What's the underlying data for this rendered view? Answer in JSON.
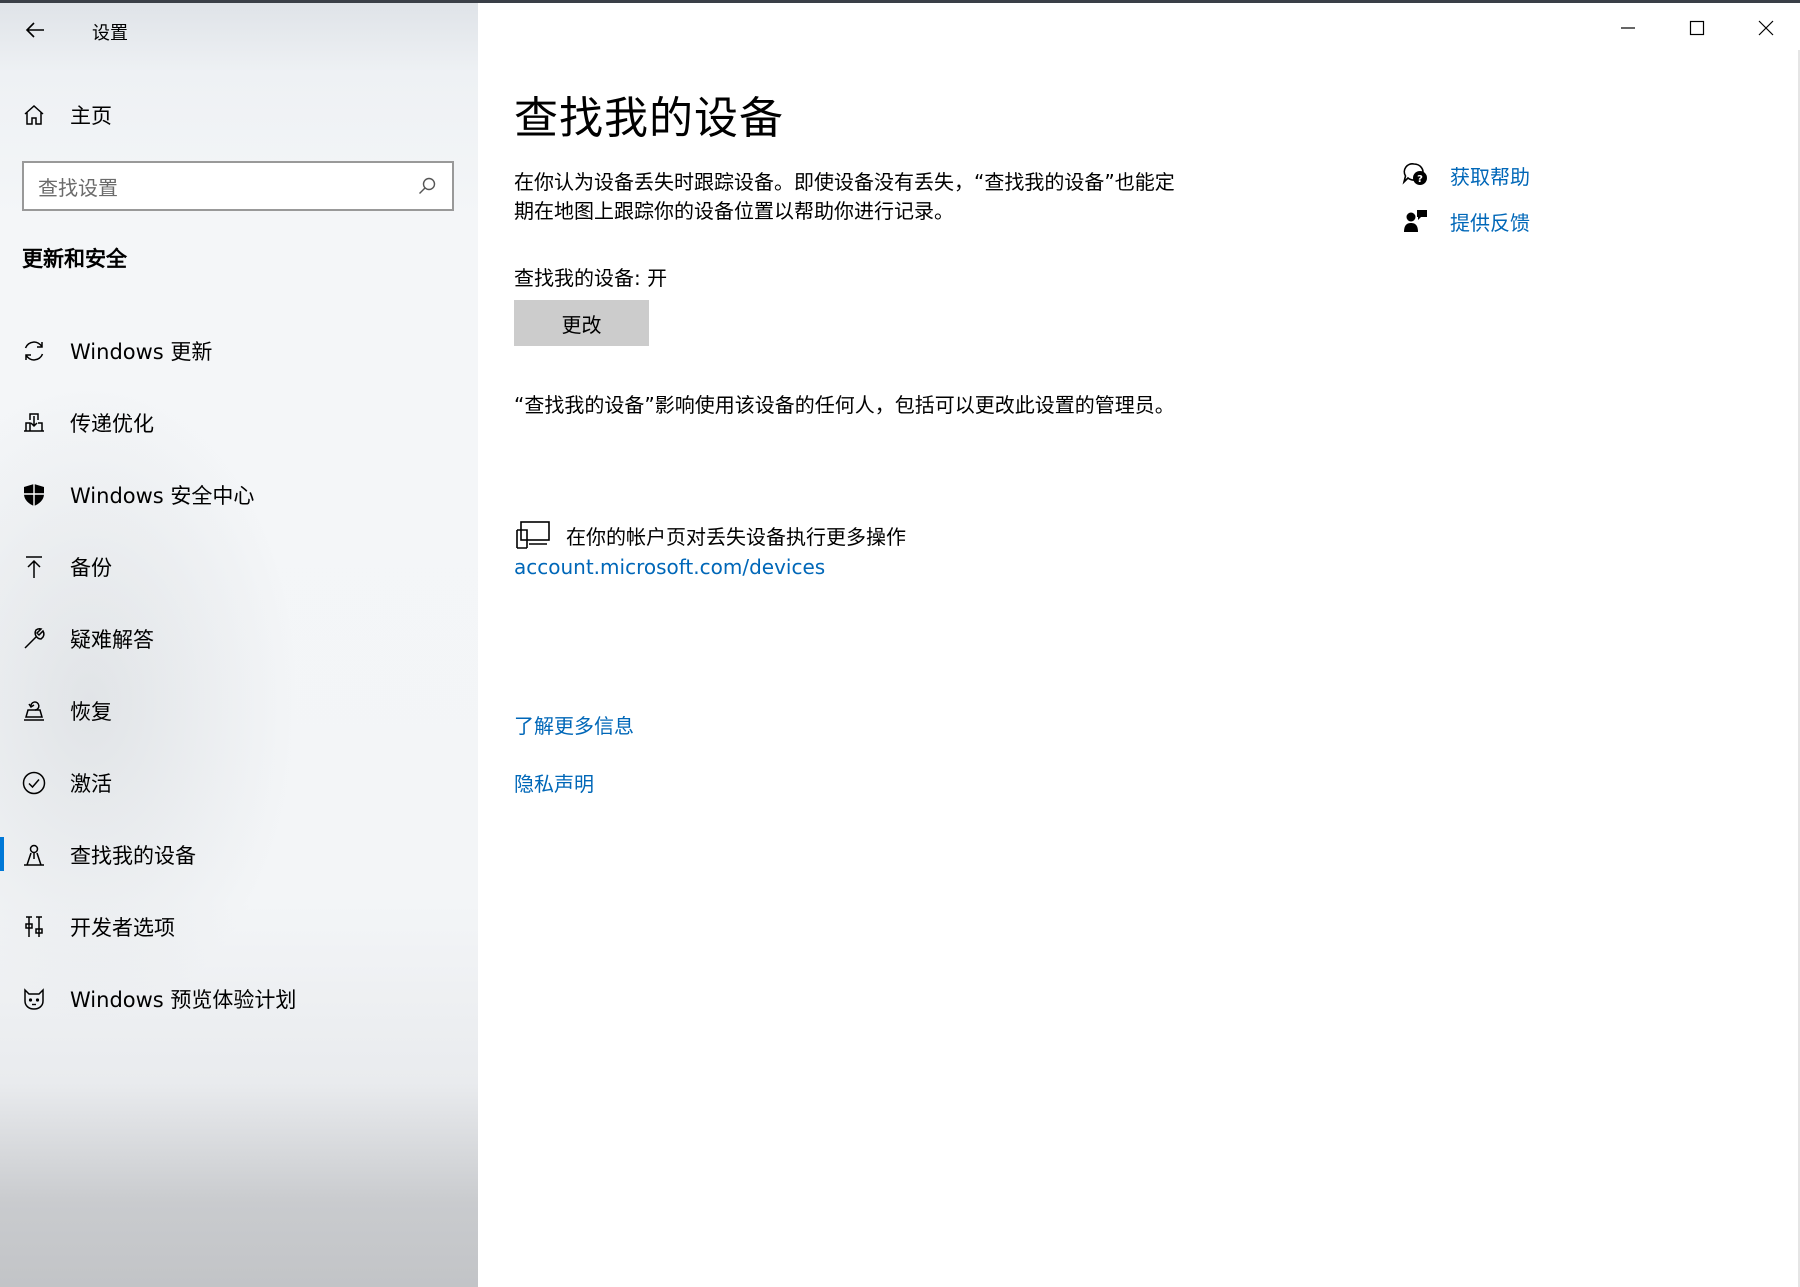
{
  "window": {
    "title": "设置",
    "controls": {
      "minimize": "minimize-icon",
      "maximize": "maximize-icon",
      "close": "close-icon"
    }
  },
  "sidebar": {
    "home_label": "主页",
    "search_placeholder": "查找设置",
    "section_title": "更新和安全",
    "items": [
      {
        "label": "Windows 更新",
        "icon": "sync-icon",
        "selected": false
      },
      {
        "label": "传递优化",
        "icon": "delivery-optimization-icon",
        "selected": false
      },
      {
        "label": "Windows 安全中心",
        "icon": "shield-icon",
        "selected": false
      },
      {
        "label": "备份",
        "icon": "backup-arrow-icon",
        "selected": false
      },
      {
        "label": "疑难解答",
        "icon": "wrench-icon",
        "selected": false
      },
      {
        "label": "恢复",
        "icon": "recovery-icon",
        "selected": false
      },
      {
        "label": "激活",
        "icon": "checkmark-circle-icon",
        "selected": false
      },
      {
        "label": "查找我的设备",
        "icon": "find-device-icon",
        "selected": true
      },
      {
        "label": "开发者选项",
        "icon": "developer-tools-icon",
        "selected": false
      },
      {
        "label": "Windows 预览体验计划",
        "icon": "insider-cat-icon",
        "selected": false
      }
    ]
  },
  "main": {
    "title": "查找我的设备",
    "description": "在你认为设备丢失时跟踪设备。即使设备没有丢失，“查找我的设备”也能定期在地图上跟踪你的设备位置以帮助你进行记录。",
    "status": "查找我的设备: 开",
    "change_button": "更改",
    "note": "“查找我的设备”影响使用该设备的任何人，包括可以更改此设置的管理员。",
    "account_text": "在你的帐户页对丢失设备执行更多操作",
    "account_link": "account.microsoft.com/devices",
    "learn_more": "了解更多信息",
    "privacy": "隐私声明"
  },
  "help": {
    "get_help": "获取帮助",
    "feedback": "提供反馈"
  },
  "colors": {
    "accent": "#0078d7",
    "link": "#0067b8",
    "button_bg": "#cccccc"
  }
}
